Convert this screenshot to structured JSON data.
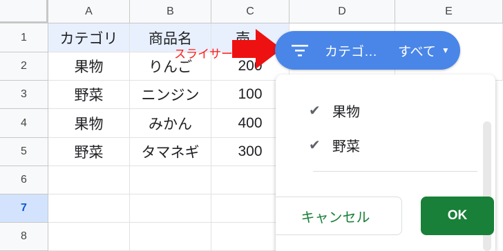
{
  "columns": [
    "A",
    "B",
    "C",
    "D",
    "E"
  ],
  "rows": [
    "1",
    "2",
    "3",
    "4",
    "5",
    "6",
    "7",
    "8"
  ],
  "active_row": "7",
  "table": {
    "headers": [
      "カテゴリ",
      "商品名",
      "売上"
    ],
    "data": [
      [
        "果物",
        "りんご",
        "200"
      ],
      [
        "野菜",
        "ニンジン",
        "100"
      ],
      [
        "果物",
        "みかん",
        "400"
      ],
      [
        "野菜",
        "タマネギ",
        "300"
      ]
    ]
  },
  "callout": {
    "text": "スライサー",
    "color": "#ff1a1a"
  },
  "slicer": {
    "icon": "filter-icon",
    "column_name": "カテゴ…",
    "value": "すべて",
    "options": [
      {
        "label": "果物",
        "checked": true
      },
      {
        "label": "野菜",
        "checked": true
      }
    ],
    "cancel_label": "キャンセル",
    "ok_label": "OK"
  },
  "colors": {
    "chip": "#4a86e8",
    "ok_button": "#188038",
    "header_cell": "#e8f0fe",
    "active_row_header": "#d3e3fd"
  }
}
